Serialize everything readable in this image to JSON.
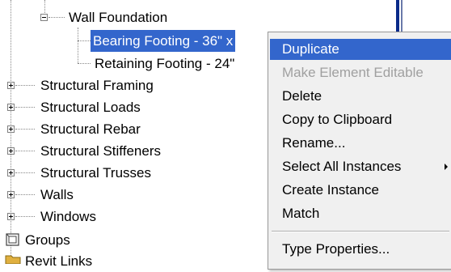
{
  "tree": {
    "wall_foundation": "Wall Foundation",
    "bearing_footing": "Bearing Footing - 36\" x",
    "retaining_footing": "Retaining Footing - 24\"",
    "items": [
      "Structural Framing",
      "Structural Loads",
      "Structural Rebar",
      "Structural Stiffeners",
      "Structural Trusses",
      "Walls",
      "Windows"
    ],
    "groups": "Groups",
    "revit_links": "Revit Links"
  },
  "context_menu": {
    "items": [
      "Duplicate",
      "Make Element Editable",
      "Delete",
      "Copy to Clipboard",
      "Rename...",
      "Select All Instances",
      "Create Instance",
      "Match",
      "Type Properties..."
    ]
  },
  "colors": {
    "selection": "#3366cc",
    "disabled": "#a0a0a0",
    "menu_background": "#f0f0f0"
  }
}
